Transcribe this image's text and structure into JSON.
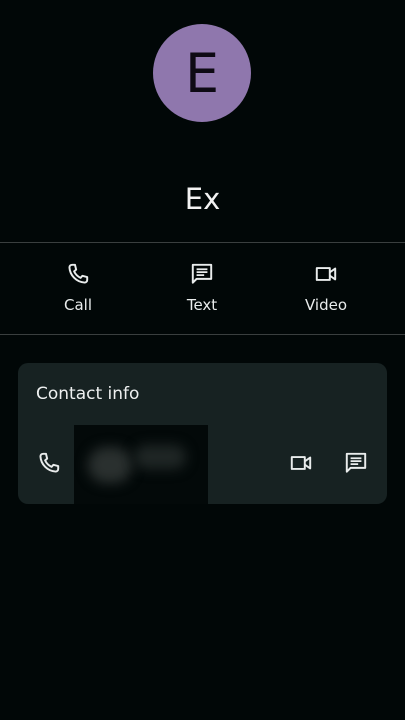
{
  "contact": {
    "initial": "E",
    "name": "Ex",
    "avatar_color": "#8f77ad"
  },
  "actions": [
    {
      "label": "Call",
      "icon": "phone-icon"
    },
    {
      "label": "Text",
      "icon": "message-icon"
    },
    {
      "label": "Video",
      "icon": "video-icon"
    }
  ],
  "contact_info": {
    "title": "Contact info",
    "phone_number_redacted": true,
    "row_icons": [
      "phone-icon",
      "video-icon",
      "message-icon"
    ]
  },
  "colors": {
    "background": "#010707",
    "card": "#172222",
    "divider": "#3a3f3f",
    "icon": "#e9ecec"
  }
}
